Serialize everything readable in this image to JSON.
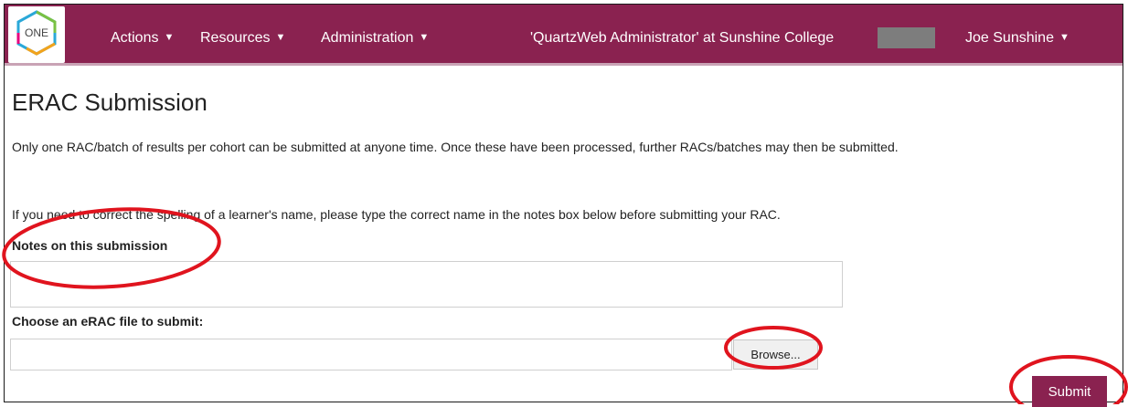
{
  "navbar": {
    "logo_text": "ONE",
    "menu": [
      {
        "label": "Actions"
      },
      {
        "label": "Resources"
      },
      {
        "label": "Administration"
      }
    ],
    "context": "'QuartzWeb Administrator' at Sunshine College",
    "user": "Joe Sunshine"
  },
  "page": {
    "title": "ERAC Submission",
    "intro_1": "Only one RAC/batch of results per cohort can be submitted at anyone time.  Once these have been processed, further RACs/batches may then be submitted.",
    "intro_2": "If you need to correct the spelling of a learner's name, please type the correct name in the notes box below before submitting your RAC.",
    "notes_label": "Notes on this submission",
    "notes_value": "",
    "file_label": "Choose an eRAC file to submit:",
    "file_value": "",
    "browse_label": "Browse...",
    "submit_label": "Submit"
  },
  "colors": {
    "brand": "#8a2250",
    "annotation": "#e0141e"
  }
}
